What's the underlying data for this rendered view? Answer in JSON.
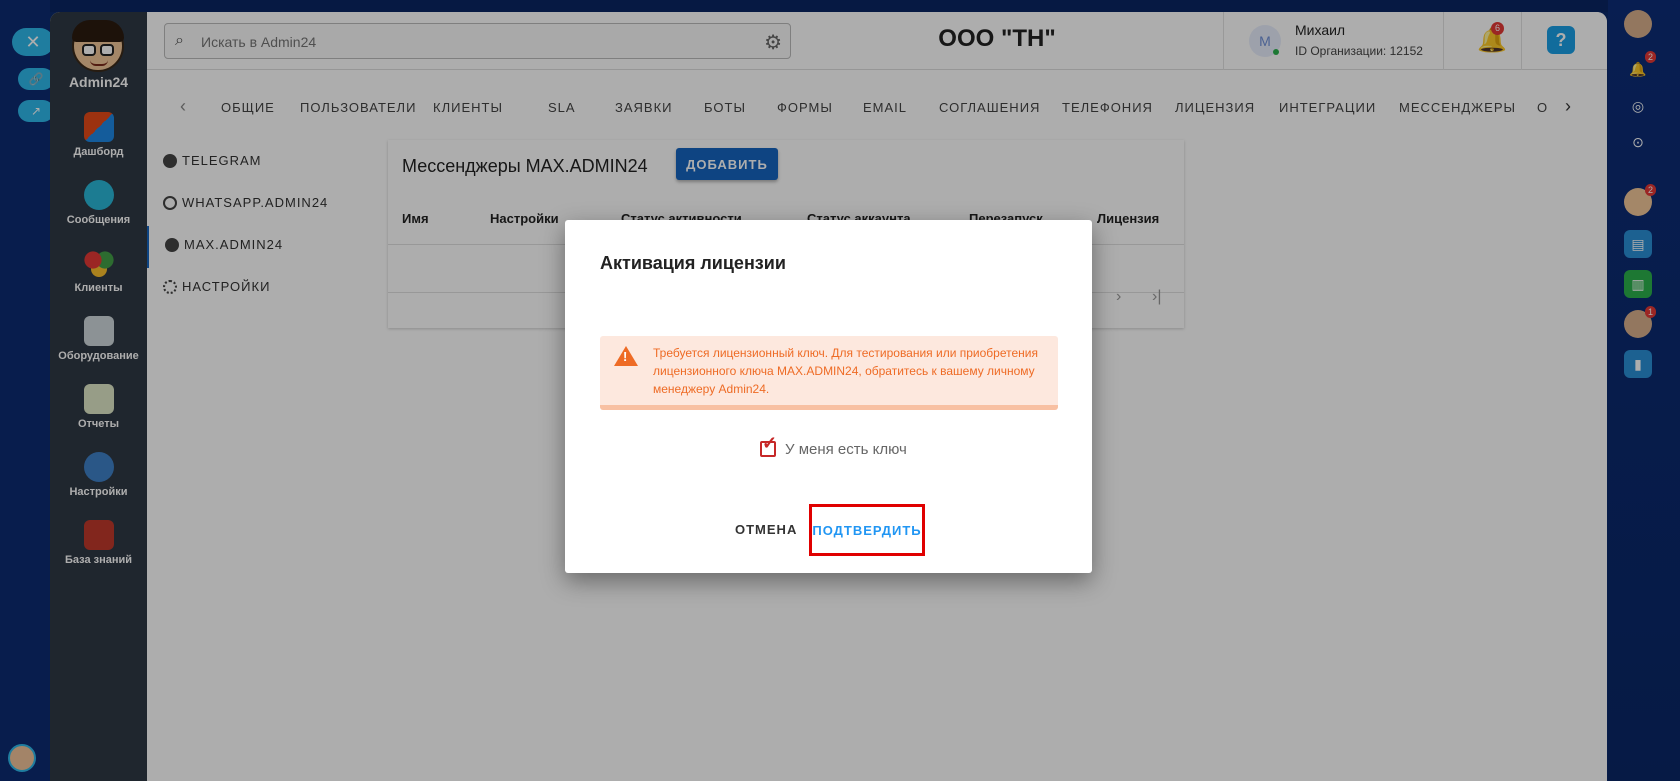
{
  "app": {
    "name": "Admin24",
    "org_title": "ООО \"ТН\""
  },
  "sidenav": [
    {
      "label": "Дашборд"
    },
    {
      "label": "Сообщения"
    },
    {
      "label": "Клиенты"
    },
    {
      "label": "Оборудование"
    },
    {
      "label": "Отчеты"
    },
    {
      "label": "Настройки"
    },
    {
      "label": "База знаний"
    }
  ],
  "search": {
    "placeholder": "Искать в Admin24"
  },
  "user": {
    "avatar_letter": "M",
    "name": "Михаил",
    "org_id": "ID Организации: 12152"
  },
  "notifications": {
    "count": "6"
  },
  "tabs": [
    "ОБЩИЕ",
    "ПОЛЬЗОВАТЕЛИ",
    "КЛИЕНТЫ",
    "SLA",
    "ЗАЯВКИ",
    "БОТЫ",
    "ФОРМЫ",
    "EMAIL",
    "СОГЛАШЕНИЯ",
    "ТЕЛЕФОНИЯ",
    "ЛИЦЕНЗИЯ",
    "ИНТЕГРАЦИИ",
    "МЕССЕНДЖЕРЫ",
    "О"
  ],
  "submenu": [
    {
      "label": "TELEGRAM"
    },
    {
      "label": "WHATSAPP.ADMIN24"
    },
    {
      "label": "MAX.ADMIN24"
    },
    {
      "label": "НАСТРОЙКИ"
    }
  ],
  "card": {
    "title": "Мессенджеры MAX.ADMIN24",
    "add_label": "ДОБАВИТЬ",
    "columns": [
      "Имя",
      "Настройки",
      "Статус активности",
      "Статус аккаунта",
      "Перезапуск",
      "Лицензия"
    ]
  },
  "modal": {
    "title": "Активация лицензии",
    "alert_text": "Требуется лицензионный ключ. Для тестирования или приобретения лицензионного ключа MAX.ADMIN24, обратитесь к вашему личному менеджеру Admin24.",
    "checkbox_label": "У меня есть ключ",
    "checkbox_checked": true,
    "cancel_label": "ОТМЕНА",
    "confirm_label": "ПОДТВЕРДИТЬ"
  },
  "right_bar_badges": {
    "bell": "2",
    "face": "2",
    "avatar": "1"
  },
  "colors": {
    "primary": "#1565c0",
    "accent": "#2196f3",
    "warning_text": "#ee6b25",
    "warning_bg": "#fde8de",
    "highlight": "#e00000",
    "sidenav_bg": "#2f3844"
  }
}
